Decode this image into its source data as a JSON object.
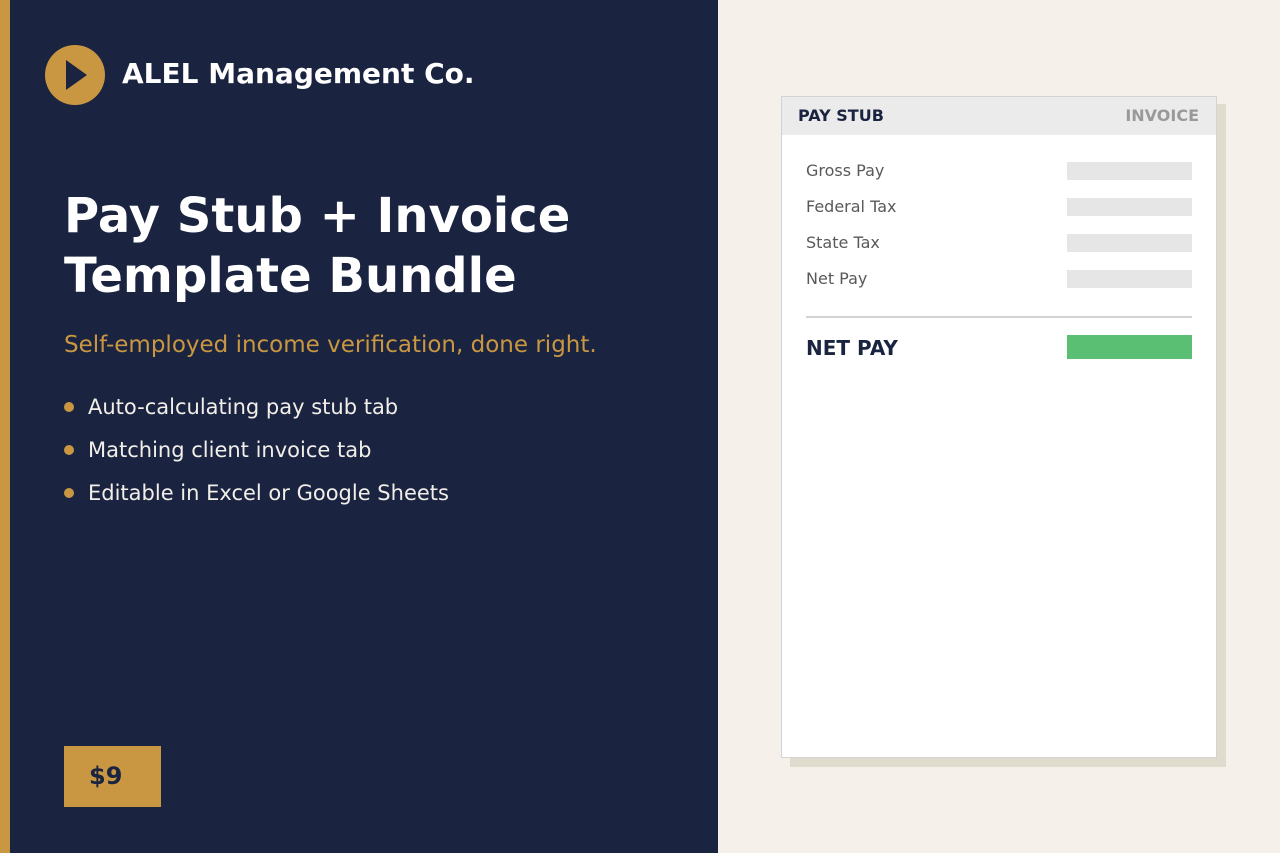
{
  "brand": {
    "logo_icon": "play-icon",
    "name": "ALEL Management Co."
  },
  "hero": {
    "title": "Pay Stub + Invoice Template Bundle",
    "subtitle": "Self-employed income verification, done right."
  },
  "features": [
    "Auto-calculating pay stub tab",
    "Matching client invoice tab",
    "Editable in Excel or Google Sheets"
  ],
  "price": "$9",
  "preview": {
    "tabs": {
      "active": "PAY STUB",
      "inactive": "INVOICE"
    },
    "rows": [
      "Gross Pay",
      "Federal Tax",
      "State Tax",
      "Net Pay"
    ],
    "total_label": "NET PAY"
  },
  "colors": {
    "navy": "#1a2340",
    "gold": "#c99742",
    "cream": "#f5f0e9",
    "green": "#5abe73"
  }
}
